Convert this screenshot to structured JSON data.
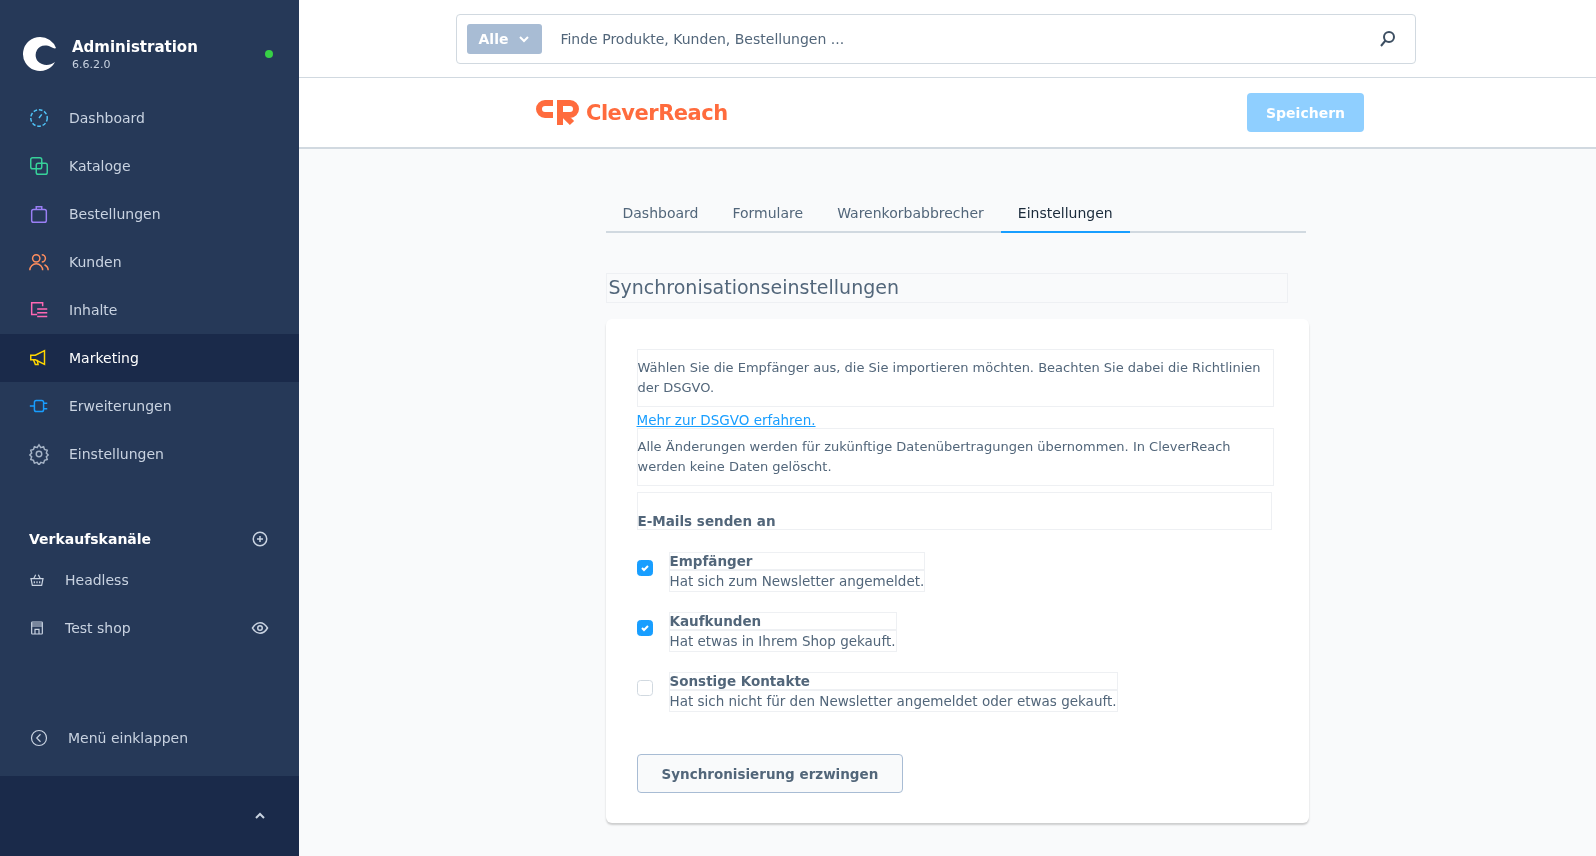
{
  "sidebar": {
    "title": "Administration",
    "version": "6.6.2.0",
    "online": true,
    "items": [
      {
        "label": "Dashboard",
        "selected": false
      },
      {
        "label": "Kataloge",
        "selected": false
      },
      {
        "label": "Bestellungen",
        "selected": false
      },
      {
        "label": "Kunden",
        "selected": false
      },
      {
        "label": "Inhalte",
        "selected": false
      },
      {
        "label": "Marketing",
        "selected": true
      },
      {
        "label": "Erweiterungen",
        "selected": false
      },
      {
        "label": "Einstellungen",
        "selected": false
      }
    ],
    "sales_channels": {
      "heading": "Verkaufskanäle",
      "items": [
        {
          "label": "Headless",
          "preview": false
        },
        {
          "label": "Test shop",
          "preview": true
        }
      ]
    },
    "collapse": "Menü einklappen"
  },
  "search": {
    "filter": "Alle",
    "placeholder": "Finde Produkte, Kunden, Bestellungen ..."
  },
  "header": {
    "logo": "CleverReach",
    "save": "Speichern",
    "save_disabled": true
  },
  "tabs": [
    {
      "label": "Dashboard",
      "selected": false
    },
    {
      "label": "Formulare",
      "selected": false
    },
    {
      "label": "Warenkorbabbrecher",
      "selected": false
    },
    {
      "label": "Einstellungen",
      "selected": true
    }
  ],
  "section_title": "Synchronisationseinstellungen",
  "card": {
    "intro": "Wählen Sie die Empfänger aus, die Sie importieren möchten. Beachten Sie dabei die Richtlinien der DSGVO.",
    "link": "Mehr zur DSGVO erfahren.",
    "note": "Alle Änderungen werden für zukünftige Datenübertragungen übernommen. In CleverReach werden keine Daten gelöscht.",
    "group_label": "E-Mails senden an",
    "options": [
      {
        "title": "Empfänger",
        "description": "Hat sich zum Newsletter angemeldet.",
        "checked": true
      },
      {
        "title": "Kaufkunden",
        "description": "Hat etwas in Ihrem Shop gekauft.",
        "checked": true
      },
      {
        "title": "Sonstige Kontakte",
        "description": "Hat sich nicht für den Newsletter angemeldet oder etwas gekauft.",
        "checked": false
      }
    ],
    "button": "Synchronisierung erzwingen"
  }
}
